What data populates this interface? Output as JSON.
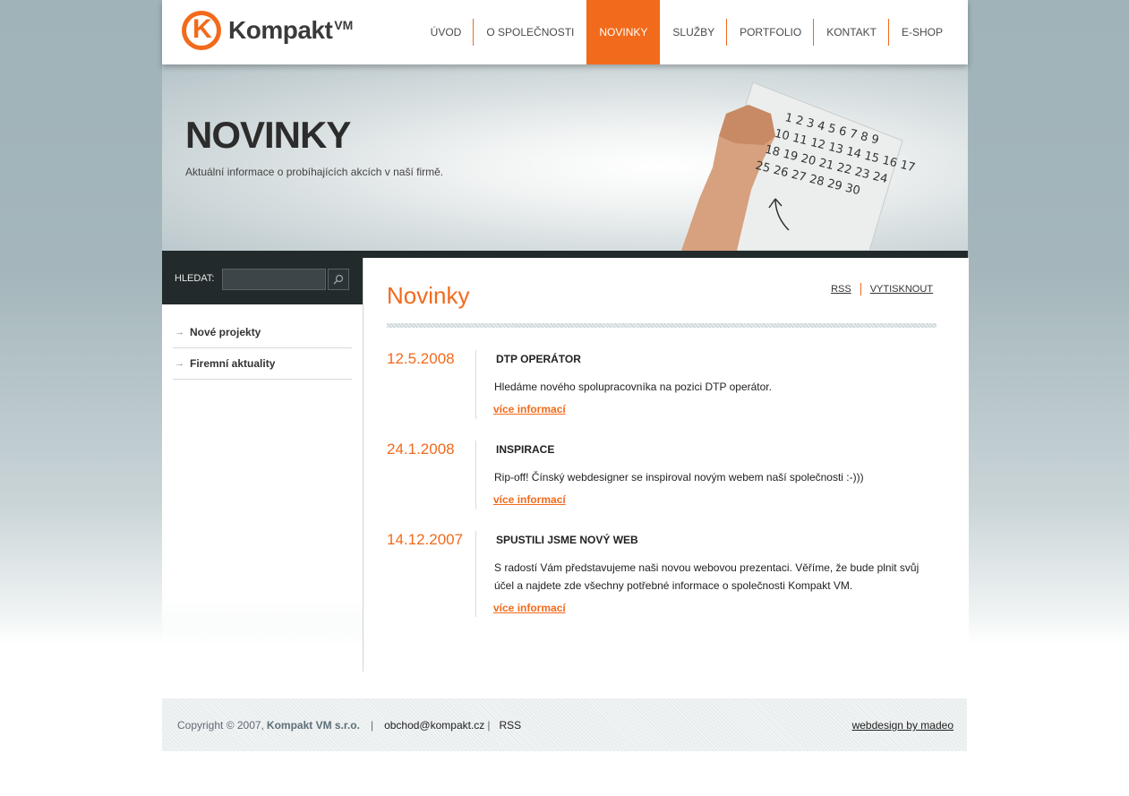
{
  "brand": {
    "logo_mark": "K",
    "name": "Kompakt",
    "suffix": "VM"
  },
  "nav": {
    "items": [
      {
        "label": "ÚVOD"
      },
      {
        "label": "O SPOLEČNOSTI"
      },
      {
        "label": "NOVINKY",
        "active": true
      },
      {
        "label": "SLUŽBY"
      },
      {
        "label": "PORTFOLIO"
      },
      {
        "label": "KONTAKT"
      },
      {
        "label": "E-SHOP"
      }
    ]
  },
  "banner": {
    "title": "NOVINKY",
    "subtitle": "Aktuální informace o probíhajících akcích v naší firmě.",
    "calendar_numbers": [
      "1 2 3 4 5 6 7 8 9",
      "10 11 12 13 14 15 16 17",
      "18 19 20 21 22 23 24",
      "25 26 27 28 29 30"
    ]
  },
  "search": {
    "label": "HLEDAT:",
    "value": "",
    "button_icon": "search-icon"
  },
  "sidebar": {
    "items": [
      {
        "label": "Nové projekty"
      },
      {
        "label": "Firemní aktuality"
      }
    ]
  },
  "main": {
    "title": "Novinky",
    "rss_label": "RSS",
    "print_label": "VYTISKNOUT",
    "news": [
      {
        "date": "12.5.2008",
        "heading": "DTP OPERÁTOR",
        "text": "Hledáme nového spolupracovníka na pozici DTP operátor.",
        "more": "více informací"
      },
      {
        "date": "24.1.2008",
        "heading": "INSPIRACE",
        "text": "Rip-off! Čínský webdesigner se inspiroval novým webem naší společnosti :-)))",
        "more": "více informací"
      },
      {
        "date": "14.12.2007",
        "heading": "SPUSTILI JSME NOVÝ WEB",
        "text": "S radostí Vám představujeme naši novou webovou prezentaci. Věříme, že bude plnit svůj účel a najdete zde všechny potřebné informace o společnosti Kompakt VM.",
        "more": "více informací"
      }
    ]
  },
  "footer": {
    "copyright": "Copyright © 2007,",
    "company": "Kompakt VM s.r.o.",
    "separator": "|",
    "email": "obchod@kompakt.cz",
    "rss": "RSS",
    "credit": "webdesign by madeo"
  },
  "colors": {
    "accent": "#f26a1b",
    "dark": "#232a2c"
  }
}
